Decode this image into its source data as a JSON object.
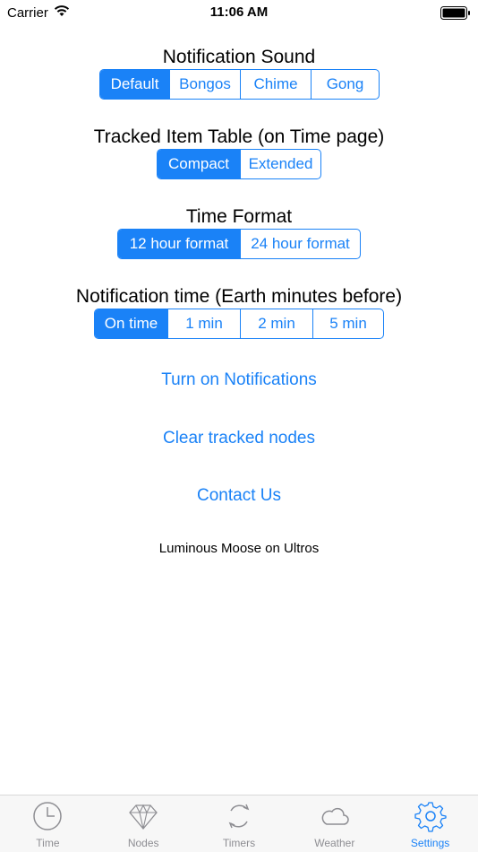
{
  "status_bar": {
    "carrier": "Carrier",
    "time": "11:06 AM"
  },
  "notification_sound": {
    "title": "Notification Sound",
    "options": [
      "Default",
      "Bongos",
      "Chime",
      "Gong"
    ],
    "selected": "Default"
  },
  "tracked_item_table": {
    "title": "Tracked Item Table (on Time page)",
    "options": [
      "Compact",
      "Extended"
    ],
    "selected": "Compact"
  },
  "time_format": {
    "title": "Time Format",
    "options": [
      "12 hour format",
      "24 hour format"
    ],
    "selected": "12 hour format"
  },
  "notification_time": {
    "title": "Notification time (Earth minutes before)",
    "options": [
      "On time",
      "1 min",
      "2 min",
      "5 min"
    ],
    "selected": "On time"
  },
  "links": {
    "turn_on_notifications": "Turn on Notifications",
    "clear_tracked_nodes": "Clear tracked nodes",
    "contact_us": "Contact Us"
  },
  "footnote": "Luminous Moose on Ultros",
  "tab_bar": {
    "tabs": [
      {
        "label": "Time",
        "icon": "clock-icon"
      },
      {
        "label": "Nodes",
        "icon": "gem-icon"
      },
      {
        "label": "Timers",
        "icon": "refresh-icon"
      },
      {
        "label": "Weather",
        "icon": "cloud-icon"
      },
      {
        "label": "Settings",
        "icon": "gear-icon"
      }
    ],
    "active": "Settings"
  },
  "colors": {
    "accent": "#1a82f7",
    "inactive": "#8e8e93"
  }
}
